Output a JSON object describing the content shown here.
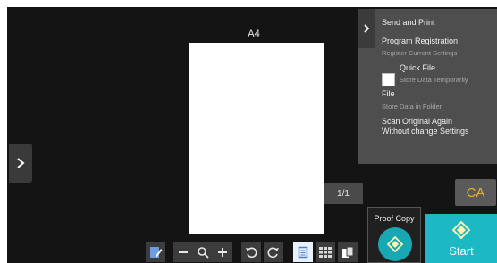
{
  "preview": {
    "paper_size": "A4",
    "page_counter": "1/1"
  },
  "side_menu": {
    "items": [
      {
        "label": "Send and Print"
      },
      {
        "label": "Program Registration",
        "sub": "Register Current Settings"
      },
      {
        "label": "Quick File",
        "sub": "Store Data Temporarily"
      },
      {
        "label": "File",
        "sub": "Store Data in Folder"
      },
      {
        "label": "Scan Original Again",
        "label2": "Without change Settings"
      }
    ]
  },
  "buttons": {
    "ca": "CA",
    "proof_copy": "Proof Copy",
    "start": "Start"
  },
  "toolbar": {
    "icons": [
      "edit-icon",
      "zoom-out-icon",
      "zoom-icon",
      "zoom-in-icon",
      "rotate-left-icon",
      "rotate-right-icon",
      "single-page-view-icon",
      "thumbnail-grid-icon",
      "copy-pages-icon"
    ]
  },
  "colors": {
    "background": "#141414",
    "panel": "#4e4e4e",
    "accent": "#1cb9c4",
    "ca_text": "#e8b12f"
  }
}
